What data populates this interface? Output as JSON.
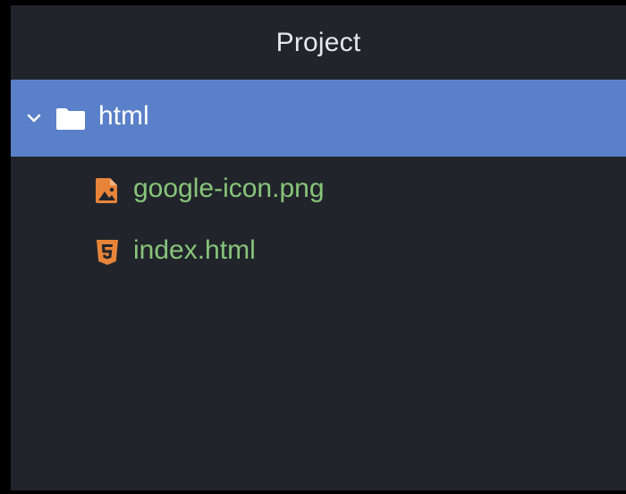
{
  "panel": {
    "title": "Project"
  },
  "tree": {
    "folder": {
      "label": "html",
      "expanded": true,
      "icon": "folder-icon",
      "chevron_icon": "chevron-down-icon"
    },
    "files": [
      {
        "label": "google-icon.png",
        "icon": "image-file-icon"
      },
      {
        "label": "index.html",
        "icon": "html5-file-icon"
      }
    ]
  },
  "colors": {
    "background": "#21252b",
    "selected_row": "#5a80c9",
    "file_text": "#88c47a",
    "file_icon": "#e8843a",
    "header_text": "#e6e7ea"
  }
}
